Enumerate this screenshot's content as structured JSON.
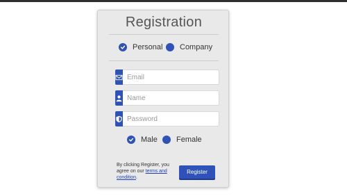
{
  "form": {
    "title": "Registration",
    "account_types": [
      {
        "label": "Personal",
        "checked": true
      },
      {
        "label": "Company",
        "checked": false
      }
    ],
    "fields": {
      "email_placeholder": "Email",
      "name_placeholder": "Name",
      "password_placeholder": "Password"
    },
    "genders": [
      {
        "label": "Male",
        "checked": true
      },
      {
        "label": "Female",
        "checked": false
      }
    ],
    "terms_prefix": "By clicking Register, you agree on our ",
    "terms_link": "terms and condition",
    "terms_suffix": ".",
    "submit_label": "Register"
  },
  "colors": {
    "accent": "#2f52b8",
    "card_bg": "#e9e9e9"
  },
  "icons": {
    "email": "envelope-icon",
    "name": "user-icon",
    "password": "shield-icon",
    "checked": "check-icon"
  }
}
